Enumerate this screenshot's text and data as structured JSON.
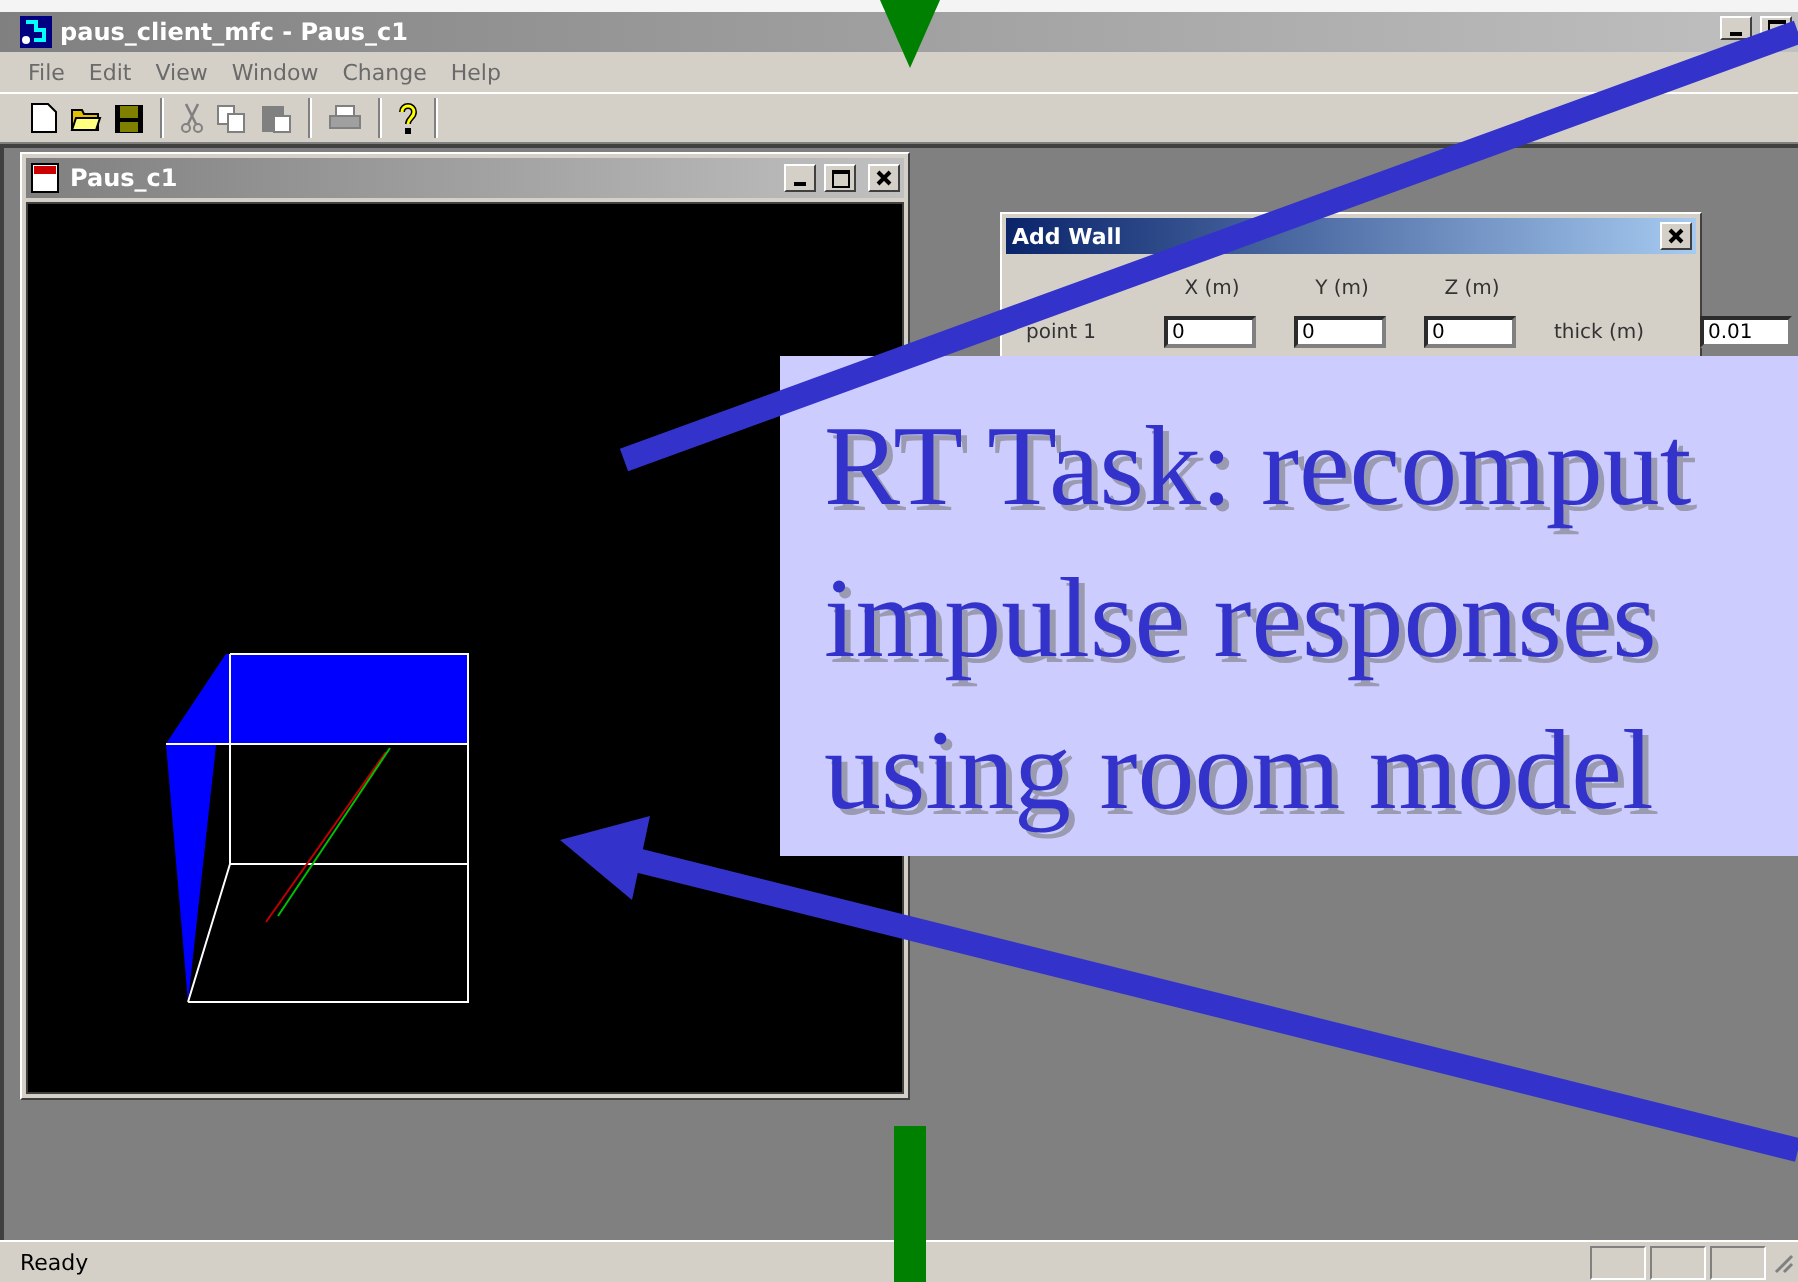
{
  "window": {
    "title": "paus_client_mfc - Paus_c1"
  },
  "menu": [
    "File",
    "Edit",
    "View",
    "Window",
    "Change",
    "Help"
  ],
  "child_window": {
    "title": "Paus_c1"
  },
  "dialog": {
    "title": "Add Wall",
    "columns": [
      "X (m)",
      "Y (m)",
      "Z (m)"
    ],
    "rows": [
      {
        "label": "point 1",
        "values": [
          "0",
          "0",
          "0"
        ],
        "extra_label": "thick (m)",
        "extra_value": "0.01"
      }
    ]
  },
  "annotation": {
    "lines": [
      "RT Task: recomput",
      "impulse responses",
      "using room model"
    ]
  },
  "status_bar": {
    "text": "Ready"
  }
}
